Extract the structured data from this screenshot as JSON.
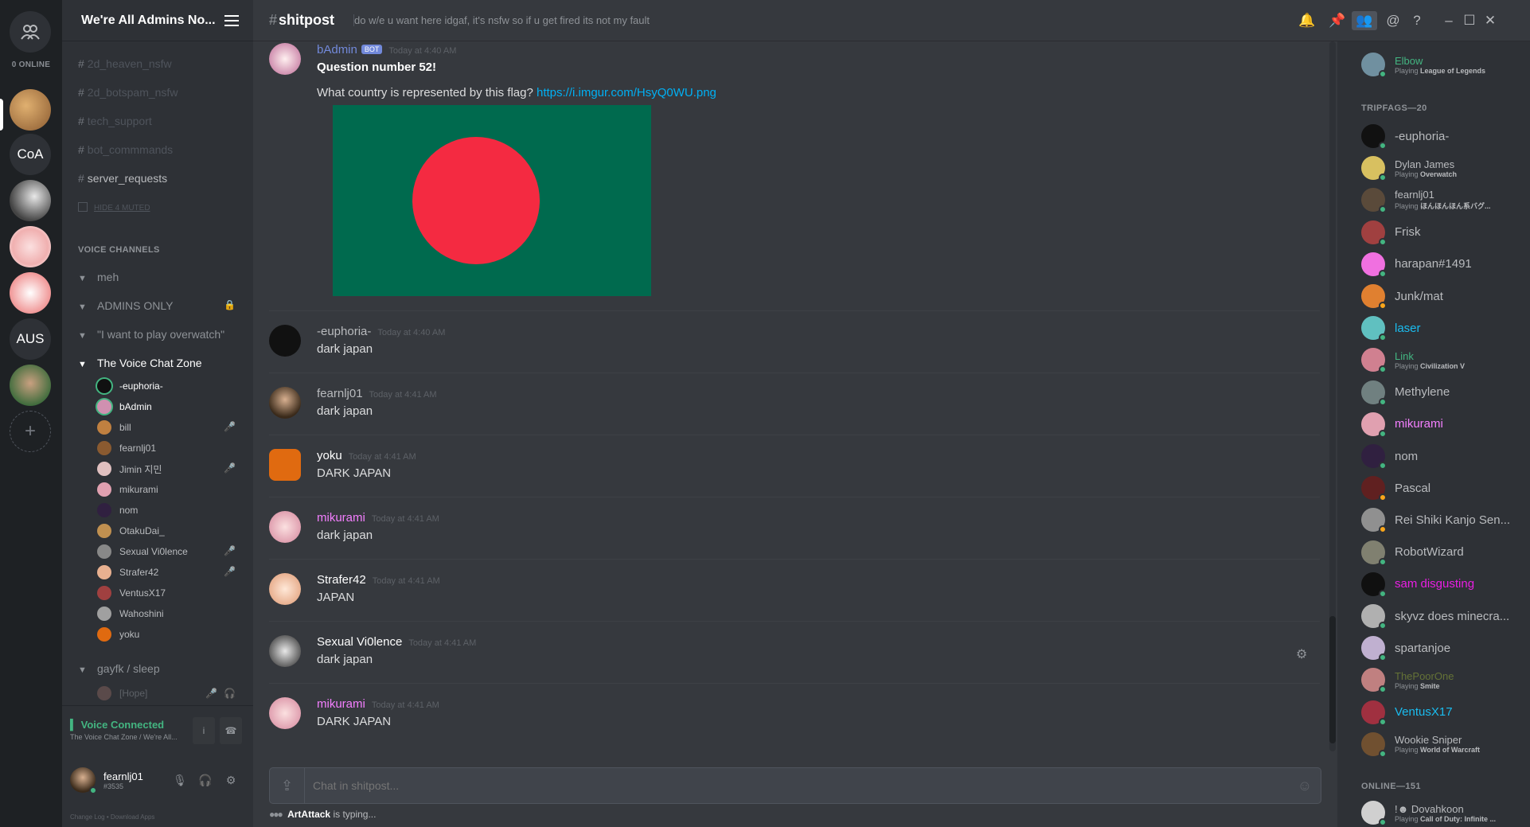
{
  "rail": {
    "online_label": "0 ONLINE",
    "servers": [
      {
        "label": "CoA"
      },
      {
        "label": "AUS"
      }
    ]
  },
  "sidebar": {
    "guild_name": "We're All Admins No...",
    "text_channels": [
      {
        "name": "2d_heaven_nsfw",
        "muted": true
      },
      {
        "name": "2d_botspam_nsfw",
        "muted": true
      },
      {
        "name": "tech_support",
        "muted": true
      },
      {
        "name": "bot_commmands",
        "muted": true
      },
      {
        "name": "server_requests",
        "muted": false
      }
    ],
    "hide_muted": "HIDE 4 MUTED",
    "voice_header": "VOICE CHANNELS",
    "voice_channels": [
      "meh",
      "ADMINS ONLY",
      "\"I want to play overwatch\"",
      "The Voice Chat Zone",
      "gayfk / sleep"
    ],
    "voice_users": [
      "-euphoria-",
      "bAdmin",
      "bill",
      "fearnlj01",
      "Jimin 지민",
      "mikurami",
      "nom",
      "OtakuDai_",
      "Sexual Vi0lence",
      "Strafer42",
      "VentusX17",
      "Wahoshini",
      "yoku"
    ],
    "sleep_user": "[Hope]",
    "voice_connected": "Voice Connected",
    "voice_connected_sub": "The Voice Chat Zone / We're All...",
    "user_name": "fearnlj01",
    "user_disc": "#3535",
    "footer": "Change Log  •  Download Apps"
  },
  "header": {
    "channel": "shitpost",
    "hash": "#",
    "topic": "do w/e u want here idgaf, it's nsfw so if u get fired its not my fault"
  },
  "messages": [
    {
      "author": "bAdmin",
      "bot": "BOT",
      "time": "Today at 4:40 AM",
      "bold": "Question number 52!",
      "text": "What country is represented by this flag? ",
      "link": "https://i.imgur.com/HsyQ0WU.png"
    },
    {
      "author": "-euphoria-",
      "time": "Today at 4:40 AM",
      "text": "dark japan"
    },
    {
      "author": "fearnlj01",
      "time": "Today at 4:41 AM",
      "text": "dark japan"
    },
    {
      "author": "yoku",
      "time": "Today at 4:41 AM",
      "text": "DARK JAPAN"
    },
    {
      "author": "mikurami",
      "time": "Today at 4:41 AM",
      "text": "dark japan"
    },
    {
      "author": "Strafer42",
      "time": "Today at 4:41 AM",
      "text": "JAPAN"
    },
    {
      "author": "Sexual Vi0lence",
      "time": "Today at 4:41 AM",
      "text": "dark japan"
    },
    {
      "author": "mikurami",
      "time": "Today at 4:41 AM",
      "text": "DARK JAPAN"
    }
  ],
  "input": {
    "placeholder": "Chat in shitpost..."
  },
  "typing": {
    "user": "ArtAttack",
    "text": " is typing..."
  },
  "members": {
    "top": {
      "name": "Elbow",
      "playing": "Playing ",
      "game": "League of Legends"
    },
    "tripfags_header": "TRIPFAGS—20",
    "tripfags": [
      {
        "name": "-euphoria-"
      },
      {
        "name": "Dylan James",
        "playing": "Playing ",
        "game": "Overwatch"
      },
      {
        "name": "fearnlj01",
        "playing": "Playing ",
        "game": "ほんほんほん系バグ..."
      },
      {
        "name": "Frisk"
      },
      {
        "name": "harapan#1491"
      },
      {
        "name": "Junk/mat"
      },
      {
        "name": "laser"
      },
      {
        "name": "Link",
        "playing": "Playing ",
        "game": "Civilization V"
      },
      {
        "name": "Methylene"
      },
      {
        "name": "mikurami"
      },
      {
        "name": "nom"
      },
      {
        "name": "Pascal"
      },
      {
        "name": "Rei Shiki Kanjo Sen..."
      },
      {
        "name": "RobotWizard"
      },
      {
        "name": "sam disgusting"
      },
      {
        "name": "skyvz does minecra..."
      },
      {
        "name": "spartanjoe"
      },
      {
        "name": "ThePoorOne",
        "playing": "Playing ",
        "game": "Smite"
      },
      {
        "name": "VentusX17"
      },
      {
        "name": "Wookie Sniper",
        "playing": "Playing ",
        "game": "World of Warcraft"
      }
    ],
    "online_header": "ONLINE—151",
    "online": [
      {
        "name": "!☻ Dovahkoon",
        "playing": "Playing ",
        "game": "Call of Duty: Infinite ..."
      }
    ]
  },
  "colors": {
    "bot": "#7289da",
    "euphoria": "#b9bbbe",
    "link": "#00b0f4",
    "green": "#43b581",
    "pink": "#f47fff",
    "magenta": "#e91ee3",
    "cyan": "#1abcef",
    "olive": "#647236"
  }
}
